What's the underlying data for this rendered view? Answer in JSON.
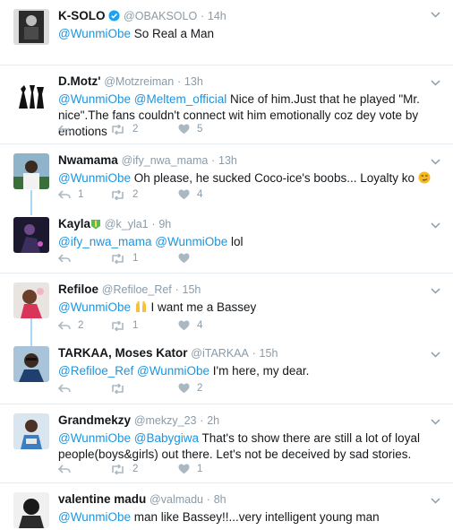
{
  "tweets": [
    {
      "name": "K-SOLO",
      "verified": true,
      "handle": "@OBAKSOLO",
      "time": "14h",
      "parts": [
        {
          "t": "@WunmiObe",
          "m": true
        },
        {
          "t": " So Real a Man",
          "m": false
        }
      ],
      "reply": "",
      "retweet": "",
      "like": ""
    },
    {
      "name": "D.Motz'",
      "handle": "@Motzreiman",
      "time": "13h",
      "parts": [
        {
          "t": "@WunmiObe",
          "m": true
        },
        {
          "t": " ",
          "m": false
        },
        {
          "t": "@Meltem_official",
          "m": true
        },
        {
          "t": " Nice of him.Just that he played \"Mr. nice\".The fans couldn't connect wit him emotionally coz dey vote by emotions",
          "m": false
        }
      ],
      "reply": "",
      "retweet": "2",
      "like": "5"
    },
    {
      "name": "Nwamama",
      "handle": "@ify_nwa_mama",
      "time": "13h",
      "parts": [
        {
          "t": "@WunmiObe",
          "m": true
        },
        {
          "t": " Oh please, he sucked Coco-ice's boobs... Loyalty ko ",
          "m": false
        }
      ],
      "emoji": "smirk-emoji",
      "reply": "1",
      "retweet": "2",
      "like": "4"
    },
    {
      "name": "Kayla",
      "badge": "green-badge-icon",
      "handle": "@k_yla1",
      "time": "9h",
      "parts": [
        {
          "t": "@ify_nwa_mama",
          "m": true
        },
        {
          "t": " ",
          "m": false
        },
        {
          "t": "@WunmiObe",
          "m": true
        },
        {
          "t": " lol",
          "m": false
        }
      ],
      "reply": "",
      "retweet": "1",
      "like": ""
    },
    {
      "name": "Refiloe",
      "handle": "@Refiloe_Ref",
      "time": "15h",
      "parts": [
        {
          "t": "@WunmiObe",
          "m": true
        },
        {
          "t": " ",
          "m": false
        }
      ],
      "emoji": "raised-hands-emoji",
      "after_emoji": " I want me a Bassey",
      "reply": "2",
      "retweet": "1",
      "like": "4"
    },
    {
      "name": "TARKAA, Moses Kator",
      "handle": "@iTARKAA",
      "time": "15h",
      "parts": [
        {
          "t": "@Refiloe_Ref",
          "m": true
        },
        {
          "t": " ",
          "m": false
        },
        {
          "t": "@WunmiObe",
          "m": true
        },
        {
          "t": " I'm here, my dear.",
          "m": false
        }
      ],
      "reply": "",
      "retweet": "",
      "like": "2"
    },
    {
      "name": "Grandmekzy",
      "handle": "@mekzy_23",
      "time": "2h",
      "parts": [
        {
          "t": "@WunmiObe",
          "m": true
        },
        {
          "t": " ",
          "m": false
        },
        {
          "t": "@Babygiwa",
          "m": true
        },
        {
          "t": " That's to show there are still a lot of loyal people(boys&girls) out there. Let's not be deceived by sad stories.",
          "m": false
        }
      ],
      "reply": "",
      "retweet": "2",
      "like": "1"
    },
    {
      "name": "valentine madu",
      "handle": "@valmadu",
      "time": "8h",
      "parts": [
        {
          "t": "@WunmiObe",
          "m": true
        },
        {
          "t": " man like Bassey!!...very intelligent young man",
          "m": false
        }
      ],
      "reply": "",
      "retweet": "",
      "like": ""
    }
  ],
  "colors": {
    "mention": "#1b95e0",
    "muted": "#8a9ba8",
    "icon": "#aab8c2",
    "thread": "#a7d8f8",
    "verified": "#1da1f2"
  }
}
